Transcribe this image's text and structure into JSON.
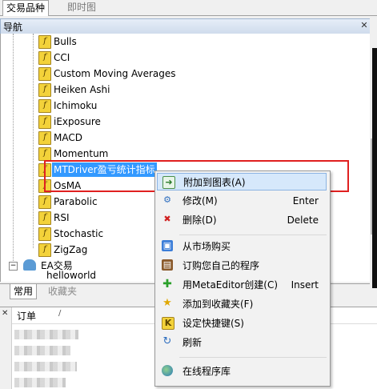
{
  "top_tabs": [
    "交易品种",
    "即时图"
  ],
  "navigator": {
    "title": "导航",
    "indicators": [
      "Bulls",
      "CCI",
      "Custom Moving Averages",
      "Heiken Ashi",
      "Ichimoku",
      "iExposure",
      "MACD",
      "Momentum",
      "MTDriver盈亏统计指标",
      "OsMA",
      "Parabolic",
      "RSI",
      "Stochastic",
      "ZigZag"
    ],
    "selected_index": 8,
    "ea_folder": "EA交易",
    "ea_child": "helloworld"
  },
  "bottom_tabs": [
    "常用",
    "收藏夹"
  ],
  "orders": {
    "title": "订单",
    "sort_glyph": "/"
  },
  "context_menu": {
    "items": [
      {
        "label": "附加到图表(A)",
        "shortcut": "",
        "icon": "attach-to-chart-icon",
        "hover": true
      },
      {
        "label": "修改(M)",
        "shortcut": "Enter",
        "icon": "gear-icon"
      },
      {
        "label": "删除(D)",
        "shortcut": "Delete",
        "icon": "delete-x-icon"
      },
      {
        "label": "从市场购买",
        "shortcut": "",
        "icon": "market-bag-icon"
      },
      {
        "label": "订购您自己的程序",
        "shortcut": "",
        "icon": "briefcase-icon"
      },
      {
        "label": "用MetaEditor创建(C)",
        "shortcut": "Insert",
        "icon": "plus-icon"
      },
      {
        "label": "添加到收藏夹(F)",
        "shortcut": "",
        "icon": "star-plus-icon"
      },
      {
        "label": "设定快捷键(S)",
        "shortcut": "",
        "icon": "hotkey-k-icon"
      },
      {
        "label": "刷新",
        "shortcut": "",
        "icon": "refresh-icon"
      },
      {
        "label": "在线程序库",
        "shortcut": "",
        "icon": "globe-icon"
      }
    ]
  },
  "colors": {
    "selection": "#3399ff",
    "highlight_box": "#e02020",
    "menu_hover": "#d6e8fb"
  }
}
